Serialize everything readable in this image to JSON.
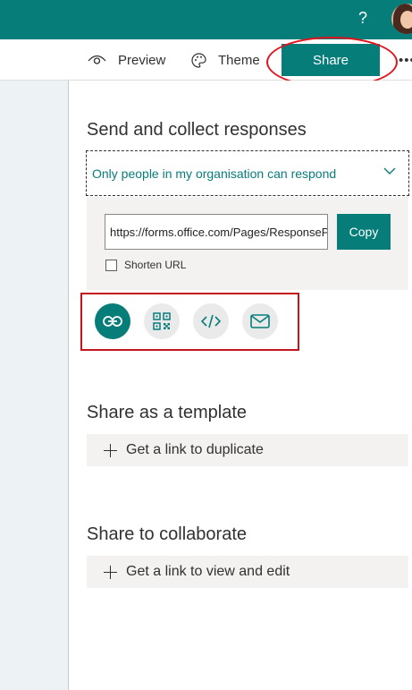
{
  "colors": {
    "accent": "#077d7a",
    "highlight": "#e0141e"
  },
  "header": {
    "help_label": "?"
  },
  "toolbar": {
    "preview_label": "Preview",
    "theme_label": "Theme",
    "share_label": "Share",
    "more_label": "•••"
  },
  "send": {
    "title": "Send and collect responses",
    "scope_value": "Only people in my organisation can respond",
    "url_value": "https://forms.office.com/Pages/ResponsePage.aspx",
    "copy_label": "Copy",
    "shorten_label": "Shorten URL",
    "shorten_checked": false,
    "methods": [
      {
        "icon": "link-icon",
        "active": true
      },
      {
        "icon": "qr-code-icon",
        "active": false
      },
      {
        "icon": "embed-code-icon",
        "active": false
      },
      {
        "icon": "mail-icon",
        "active": false
      }
    ]
  },
  "template": {
    "title": "Share as a template",
    "action_label": "Get a link to duplicate"
  },
  "collaborate": {
    "title": "Share to collaborate",
    "action_label": "Get a link to view and edit"
  }
}
